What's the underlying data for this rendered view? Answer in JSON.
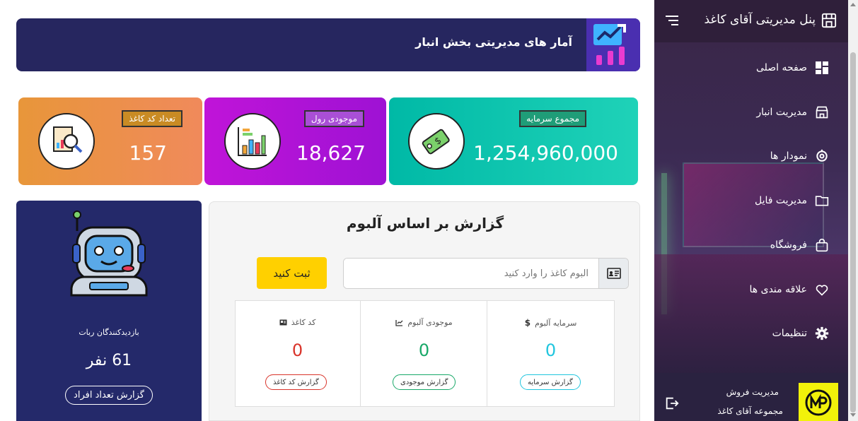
{
  "sidebar": {
    "title": "پنل مدیریتی آقای کاغذ",
    "items": [
      {
        "label": "صفحه اصلی",
        "icon": "dashboard-grid-icon"
      },
      {
        "label": "مدیریت انبار",
        "icon": "store-icon"
      },
      {
        "label": "نمودار ها",
        "icon": "chart-ring-icon"
      },
      {
        "label": "مدیریت فایل",
        "icon": "folder-icon"
      },
      {
        "label": "فروشگاه",
        "icon": "shopping-bag-icon"
      },
      {
        "label": "علاقه مندی ها",
        "icon": "heart-icon"
      },
      {
        "label": "تنظیمات",
        "icon": "gear-icon"
      }
    ],
    "footer": {
      "line1": "مدیریت فروش",
      "line2": "مجموعه آقای کاغذ"
    }
  },
  "banner": {
    "title": "آمار های مدیریتی بخش انبار"
  },
  "cards": {
    "capital": {
      "label": "مجموع سرمایه",
      "value": "1,254,960,000"
    },
    "roll": {
      "label": "موجودی رول",
      "value": "18,627"
    },
    "codes": {
      "label": "تعداد کد کاغذ",
      "value": "157"
    }
  },
  "visitors": {
    "caption": "بازدیدکنندگان ربات",
    "count": "61 نفر",
    "button": "گزارش تعداد افراد"
  },
  "report": {
    "title": "گزارش بر اساس آلبوم",
    "placeholder": "آلبوم کاغذ را وارد کنید",
    "submit": "ثبت کنید",
    "stats": [
      {
        "label": "سرمایه آلبوم",
        "value": "0",
        "button": "گزارش سرمایه"
      },
      {
        "label": "موجودی آلبوم",
        "value": "0",
        "button": "گزارش موجودی"
      },
      {
        "label": "کد کاغذ",
        "value": "0",
        "button": "گزارش کد کاغذ"
      }
    ]
  },
  "colors": {
    "sidebar": "#3b2a52",
    "banner": "#26265f",
    "teal": "#00b9a6",
    "purple": "#c014d8",
    "orange": "#e8963a",
    "submit": "#ffd000",
    "robot_panel": "#24296a"
  }
}
